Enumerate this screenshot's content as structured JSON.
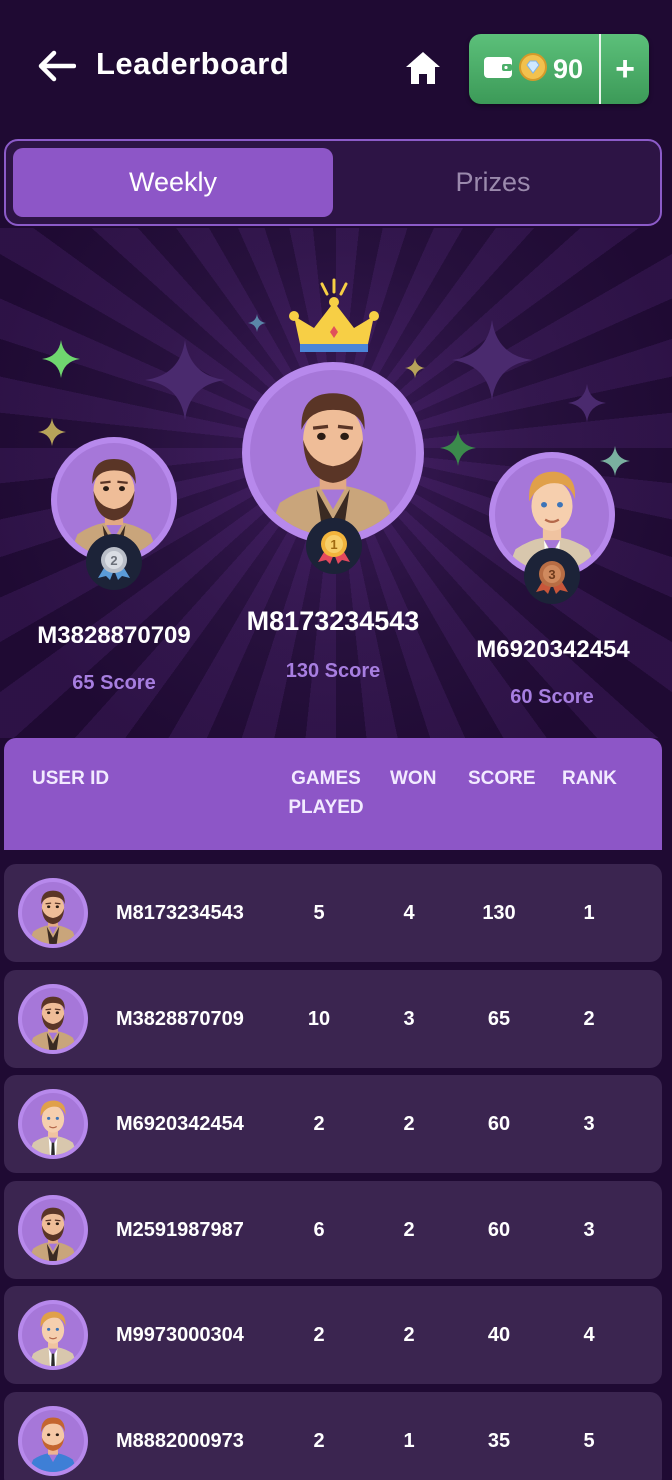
{
  "header": {
    "title": "Leaderboard",
    "wallet_amount": "90",
    "wallet_add": "+"
  },
  "tabs": [
    {
      "label": "Weekly",
      "active": true
    },
    {
      "label": "Prizes",
      "active": false
    }
  ],
  "podium": {
    "first": {
      "user_id": "M8173234543",
      "score": "130 Score",
      "rank": "1"
    },
    "second": {
      "user_id": "M3828870709",
      "score": "65 Score",
      "rank": "2"
    },
    "third": {
      "user_id": "M6920342454",
      "score": "60 Score",
      "rank": "3"
    }
  },
  "table": {
    "headers": {
      "user_id": "USER ID",
      "games_played_1": "GAMES",
      "games_played_2": "PLAYED",
      "won": "WON",
      "score": "SCORE",
      "rank": "RANK"
    },
    "rows": [
      {
        "user_id": "M8173234543",
        "games_played": "5",
        "won": "4",
        "score": "130",
        "rank": "1",
        "avatar": "bearded-man-avatar"
      },
      {
        "user_id": "M3828870709",
        "games_played": "10",
        "won": "3",
        "score": "65",
        "rank": "2",
        "avatar": "bearded-man-avatar"
      },
      {
        "user_id": "M6920342454",
        "games_played": "2",
        "won": "2",
        "score": "60",
        "rank": "3",
        "avatar": "blond-man-avatar"
      },
      {
        "user_id": "M2591987987",
        "games_played": "6",
        "won": "2",
        "score": "60",
        "rank": "3",
        "avatar": "bearded-man-avatar"
      },
      {
        "user_id": "M9973000304",
        "games_played": "2",
        "won": "2",
        "score": "40",
        "rank": "4",
        "avatar": "blond-man-avatar"
      },
      {
        "user_id": "M8882000973",
        "games_played": "2",
        "won": "1",
        "score": "35",
        "rank": "5",
        "avatar": "red-haired-man-avatar"
      }
    ]
  },
  "colors": {
    "background": "#1f0a33",
    "accent": "#8d56c7",
    "wallet_green": "#4caf6a",
    "row_bg": "#3b2550",
    "score_text": "#a77ee0"
  }
}
